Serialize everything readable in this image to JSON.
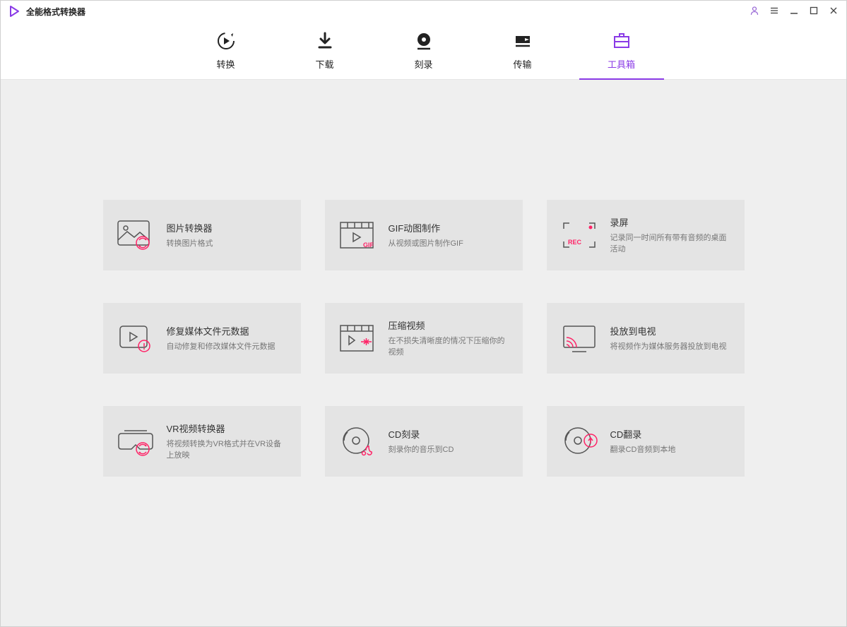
{
  "app": {
    "title": "全能格式转换器"
  },
  "nav": {
    "items": [
      {
        "label": "转换"
      },
      {
        "label": "下载"
      },
      {
        "label": "刻录"
      },
      {
        "label": "传输"
      },
      {
        "label": "工具箱"
      }
    ]
  },
  "tools": [
    {
      "title": "图片转换器",
      "desc": "转换图片格式"
    },
    {
      "title": "GIF动图制作",
      "desc": "从视频或图片制作GIF"
    },
    {
      "title": "录屏",
      "desc": "记录同一时间所有带有音频的桌面活动"
    },
    {
      "title": "修复媒体文件元数据",
      "desc": "自动修复和修改媒体文件元数据"
    },
    {
      "title": "压缩视频",
      "desc": "在不损失清晰度的情况下压缩你的视频"
    },
    {
      "title": "投放到电视",
      "desc": "将视频作为媒体服务器投放到电视"
    },
    {
      "title": "VR视频转换器",
      "desc": "将视频转换为VR格式并在VR设备上放映"
    },
    {
      "title": "CD刻录",
      "desc": "刻录你的音乐到CD"
    },
    {
      "title": "CD翻录",
      "desc": "翻录CD音频到本地"
    }
  ]
}
